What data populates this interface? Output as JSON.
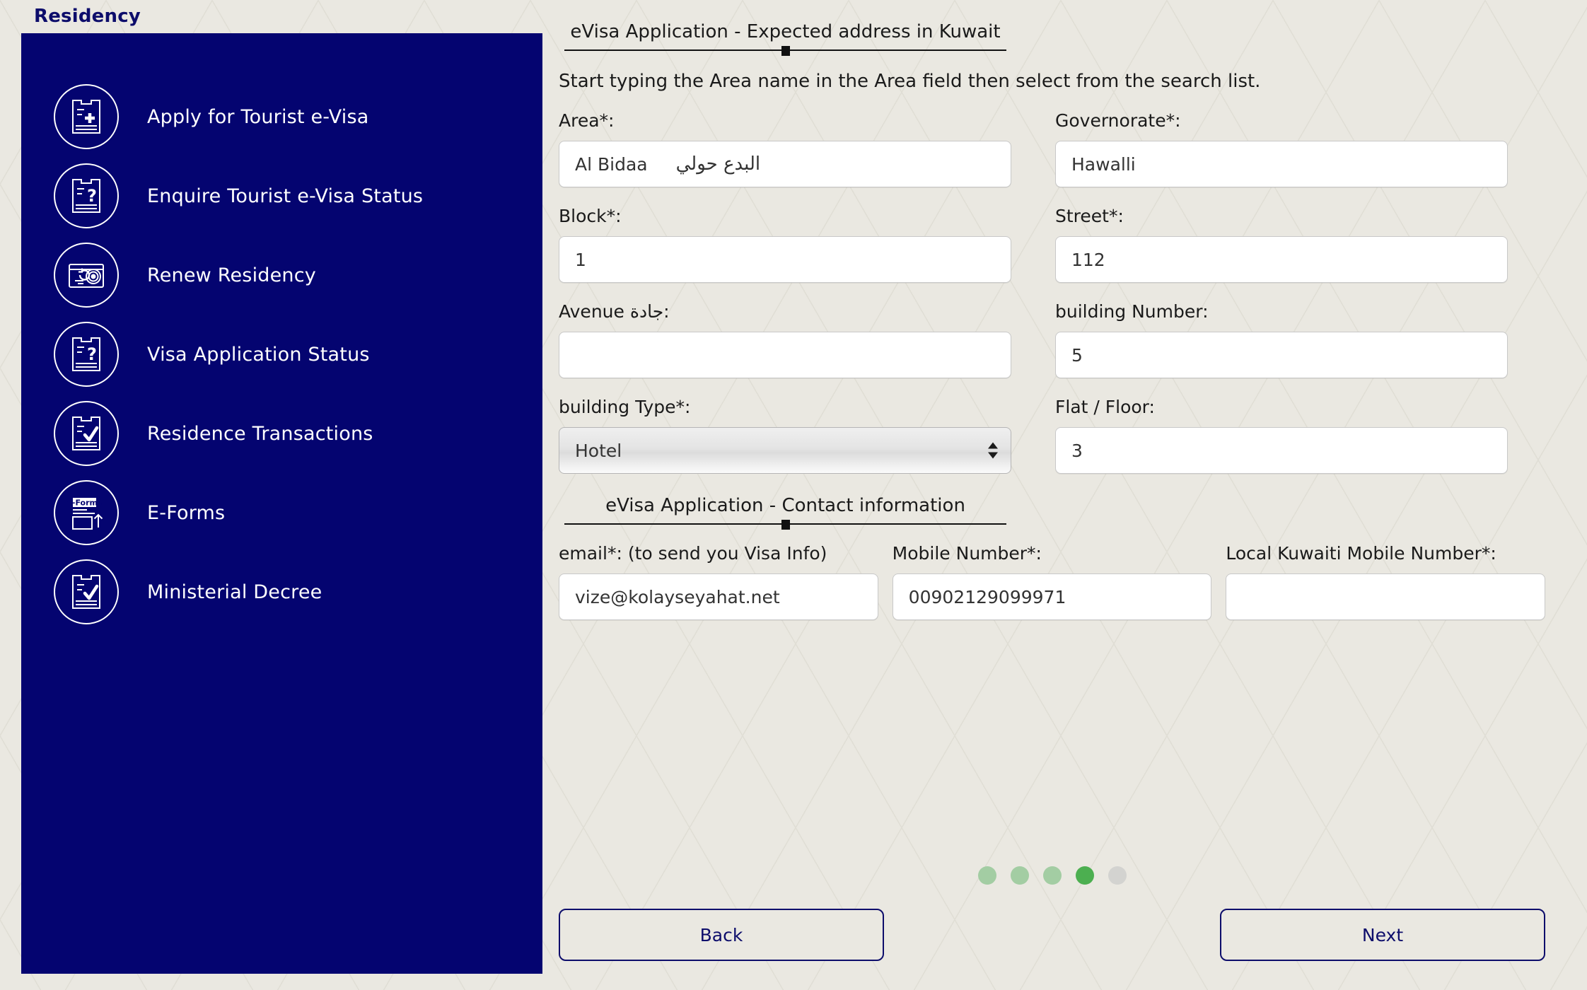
{
  "header": {
    "title": "Residency"
  },
  "colors": {
    "sidebar_navy": "#040470",
    "accent_navy": "#0d0d6b",
    "page_background": "#eae8e1",
    "dot_active": "#4aa köp"
  },
  "sidebar": {
    "items": [
      {
        "label": "Apply for Tourist e-Visa",
        "icon": "document-plus-icon"
      },
      {
        "label": "Enquire Tourist e-Visa Status",
        "icon": "document-question-icon"
      },
      {
        "label": "Renew Residency",
        "icon": "residency-card-refresh-icon"
      },
      {
        "label": "Visa Application Status",
        "icon": "document-question-icon"
      },
      {
        "label": "Residence Transactions",
        "icon": "document-check-icon"
      },
      {
        "label": "E-Forms",
        "icon": "e-forms-upload-icon"
      },
      {
        "label": "Ministerial Decree",
        "icon": "document-check-icon"
      }
    ]
  },
  "main": {
    "address_section": {
      "title": "eVisa Application - Expected address in Kuwait",
      "hint": "Start typing the Area name in the Area field then select from the search list."
    },
    "fields": {
      "area": {
        "label": "Area*:",
        "value_en": "Al Bidaa",
        "value_ar": "البدع حولي",
        "placeholder": ""
      },
      "governorate": {
        "label": "Governorate*:",
        "value": "Hawalli",
        "placeholder": ""
      },
      "block": {
        "label": "Block*:",
        "value": "1",
        "placeholder": ""
      },
      "street": {
        "label": "Street*:",
        "value": "112",
        "placeholder": ""
      },
      "avenue": {
        "label": "Avenue جادة:",
        "value": "",
        "placeholder": ""
      },
      "building_number": {
        "label": "building Number:",
        "value": "5",
        "placeholder": ""
      },
      "building_type": {
        "label": "building Type*:",
        "value": "Hotel",
        "options": [
          "Hotel"
        ]
      },
      "flat_floor": {
        "label": "Flat / Floor:",
        "value": "3",
        "placeholder": ""
      }
    },
    "contact_section": {
      "title": "eVisa Application - Contact information"
    },
    "contact_fields": {
      "email": {
        "label": "email*: (to send you Visa Info)",
        "value": "vize@kolayseyahat.net",
        "placeholder": ""
      },
      "mobile": {
        "label": "Mobile Number*:",
        "value": "00902129099971",
        "placeholder": ""
      },
      "local_mobile": {
        "label": "Local Kuwaiti Mobile Number*:",
        "value": "",
        "placeholder": ""
      }
    },
    "progress_dots": [
      {
        "state": "done",
        "color": "#a3cda3"
      },
      {
        "state": "done",
        "color": "#a3cda3"
      },
      {
        "state": "done",
        "color": "#a3cda3"
      },
      {
        "state": "active",
        "color": "#4caf50"
      },
      {
        "state": "pending",
        "color": "#d3d3d0"
      }
    ],
    "buttons": {
      "back": "Back",
      "next": "Next"
    }
  }
}
